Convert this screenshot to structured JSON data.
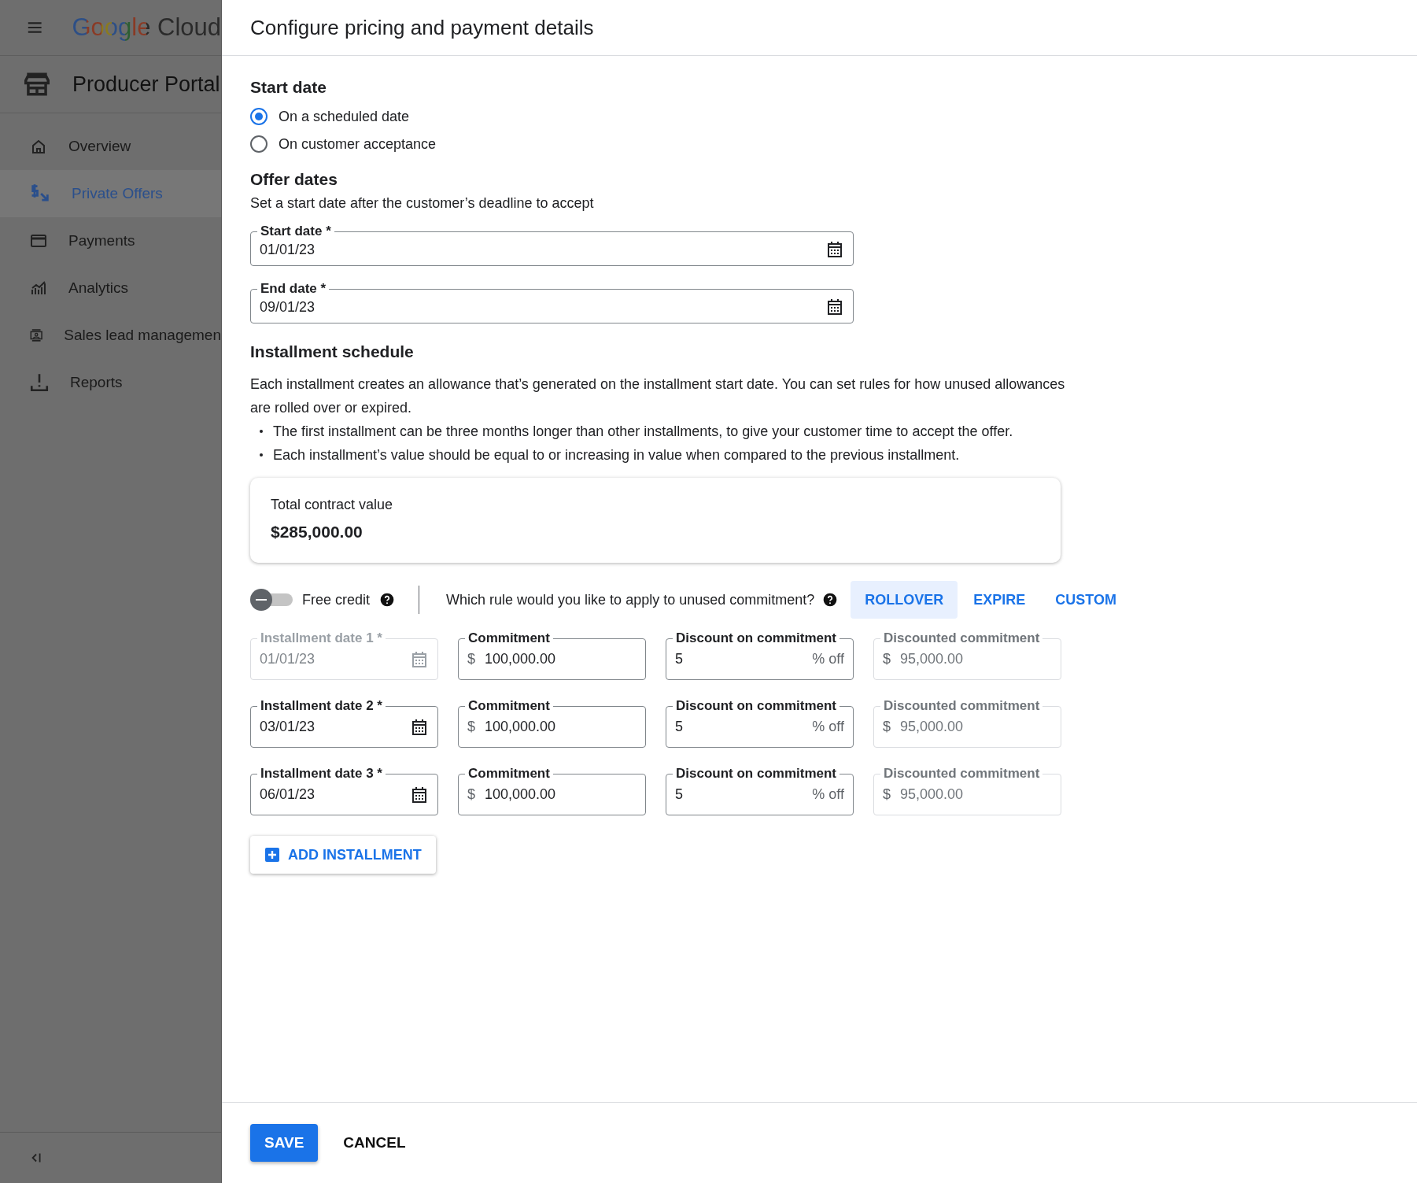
{
  "sidebar": {
    "logo": "Google Cloud",
    "product_title": "Producer Portal",
    "items": [
      {
        "label": "Overview",
        "selected": false
      },
      {
        "label": "Private Offers",
        "selected": true
      },
      {
        "label": "Payments",
        "selected": false
      },
      {
        "label": "Analytics",
        "selected": false
      },
      {
        "label": "Sales lead managemen",
        "selected": false
      },
      {
        "label": "Reports",
        "selected": false
      }
    ]
  },
  "dialog": {
    "title": "Configure pricing and payment details",
    "start_date": {
      "heading": "Start date",
      "options": [
        {
          "label": "On a scheduled date",
          "selected": true
        },
        {
          "label": "On customer acceptance",
          "selected": false
        }
      ]
    },
    "offer_dates": {
      "heading": "Offer dates",
      "hint": "Set a start date after the customer’s deadline to accept",
      "fields": [
        {
          "label": "Start date *",
          "value": "01/01/23"
        },
        {
          "label": "End date *",
          "value": "09/01/23"
        }
      ]
    },
    "installment_schedule": {
      "heading": "Installment schedule",
      "description": "Each installment creates an allowance that’s generated on the installment start date. You can set rules for how unused allowances are rolled over or expired.",
      "bullets": [
        "The first installment can be three months longer than other installments, to give your customer time to accept the offer.",
        "Each installment’s value should be equal to or increasing in value when compared to the previous installment."
      ],
      "total": {
        "label": "Total contract value",
        "value": "$285,000.00"
      },
      "free_credit": {
        "label": "Free credit",
        "on": false
      },
      "rule_question": "Which rule would you like to apply to unused commitment?",
      "rule_options": [
        {
          "label": "ROLLOVER",
          "selected": true
        },
        {
          "label": "EXPIRE",
          "selected": false
        },
        {
          "label": "CUSTOM",
          "selected": false
        }
      ],
      "installments": [
        {
          "date_label": "Installment date 1 *",
          "date_value": "01/01/23",
          "disabled": true,
          "commitment_label": "Commitment",
          "currency": "$",
          "commitment_value": "100,000.00",
          "discount_label": "Discount on commitment",
          "discount_value": "5",
          "discount_suffix": "% off",
          "discounted_label": "Discounted commitment",
          "discounted_currency": "$",
          "discounted_value": "95,000.00"
        },
        {
          "date_label": "Installment date 2 *",
          "date_value": "03/01/23",
          "disabled": false,
          "commitment_label": "Commitment",
          "currency": "$",
          "commitment_value": "100,000.00",
          "discount_label": "Discount on commitment",
          "discount_value": "5",
          "discount_suffix": "% off",
          "discounted_label": "Discounted commitment",
          "discounted_currency": "$",
          "discounted_value": "95,000.00"
        },
        {
          "date_label": "Installment date  3 *",
          "date_value": "06/01/23",
          "disabled": false,
          "commitment_label": "Commitment",
          "currency": "$",
          "commitment_value": "100,000.00",
          "discount_label": "Discount on commitment",
          "discount_value": "5",
          "discount_suffix": "% off",
          "discounted_label": "Discounted commitment",
          "discounted_currency": "$",
          "discounted_value": "95,000.00"
        }
      ],
      "add_button": "ADD INSTALLMENT"
    },
    "buttons": [
      {
        "label": "SAVE",
        "kind": "primary"
      },
      {
        "label": "CANCEL",
        "kind": "text"
      }
    ]
  }
}
